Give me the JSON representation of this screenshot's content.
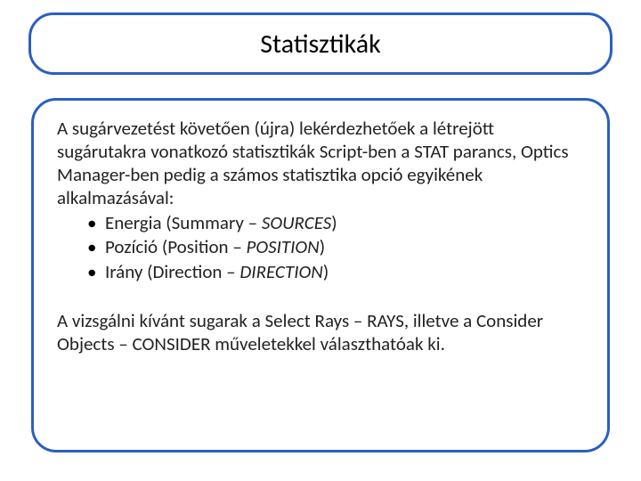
{
  "title": "Statisztikák",
  "para1": {
    "t1": "A sugárvezetést követően (újra) lekérdezhetőek a létrejött sugárutakra vonatkozó statisztikák Script-ben a ",
    "stat": "STAT",
    "t2": " parancs, Optics Manager-ben pedig a számos statisztika opció egyikének alkalmazásával:"
  },
  "bullets": [
    {
      "pre": "Energia (Summary – ",
      "key": "SOURCES",
      "post": ")"
    },
    {
      "pre": "Pozíció (Position – ",
      "key": "POSITION",
      "post": ")"
    },
    {
      "pre": "Irány (Direction – ",
      "key": "DIRECTION",
      "post": ")"
    }
  ],
  "para2": {
    "t1": "A vizsgálni kívánt sugarak a Select Rays – ",
    "rays": "RAYS",
    "t2": ", illetve a Consider Objects – ",
    "consider": "CONSIDER",
    "t3": " műveletekkel választhatóak ki."
  }
}
